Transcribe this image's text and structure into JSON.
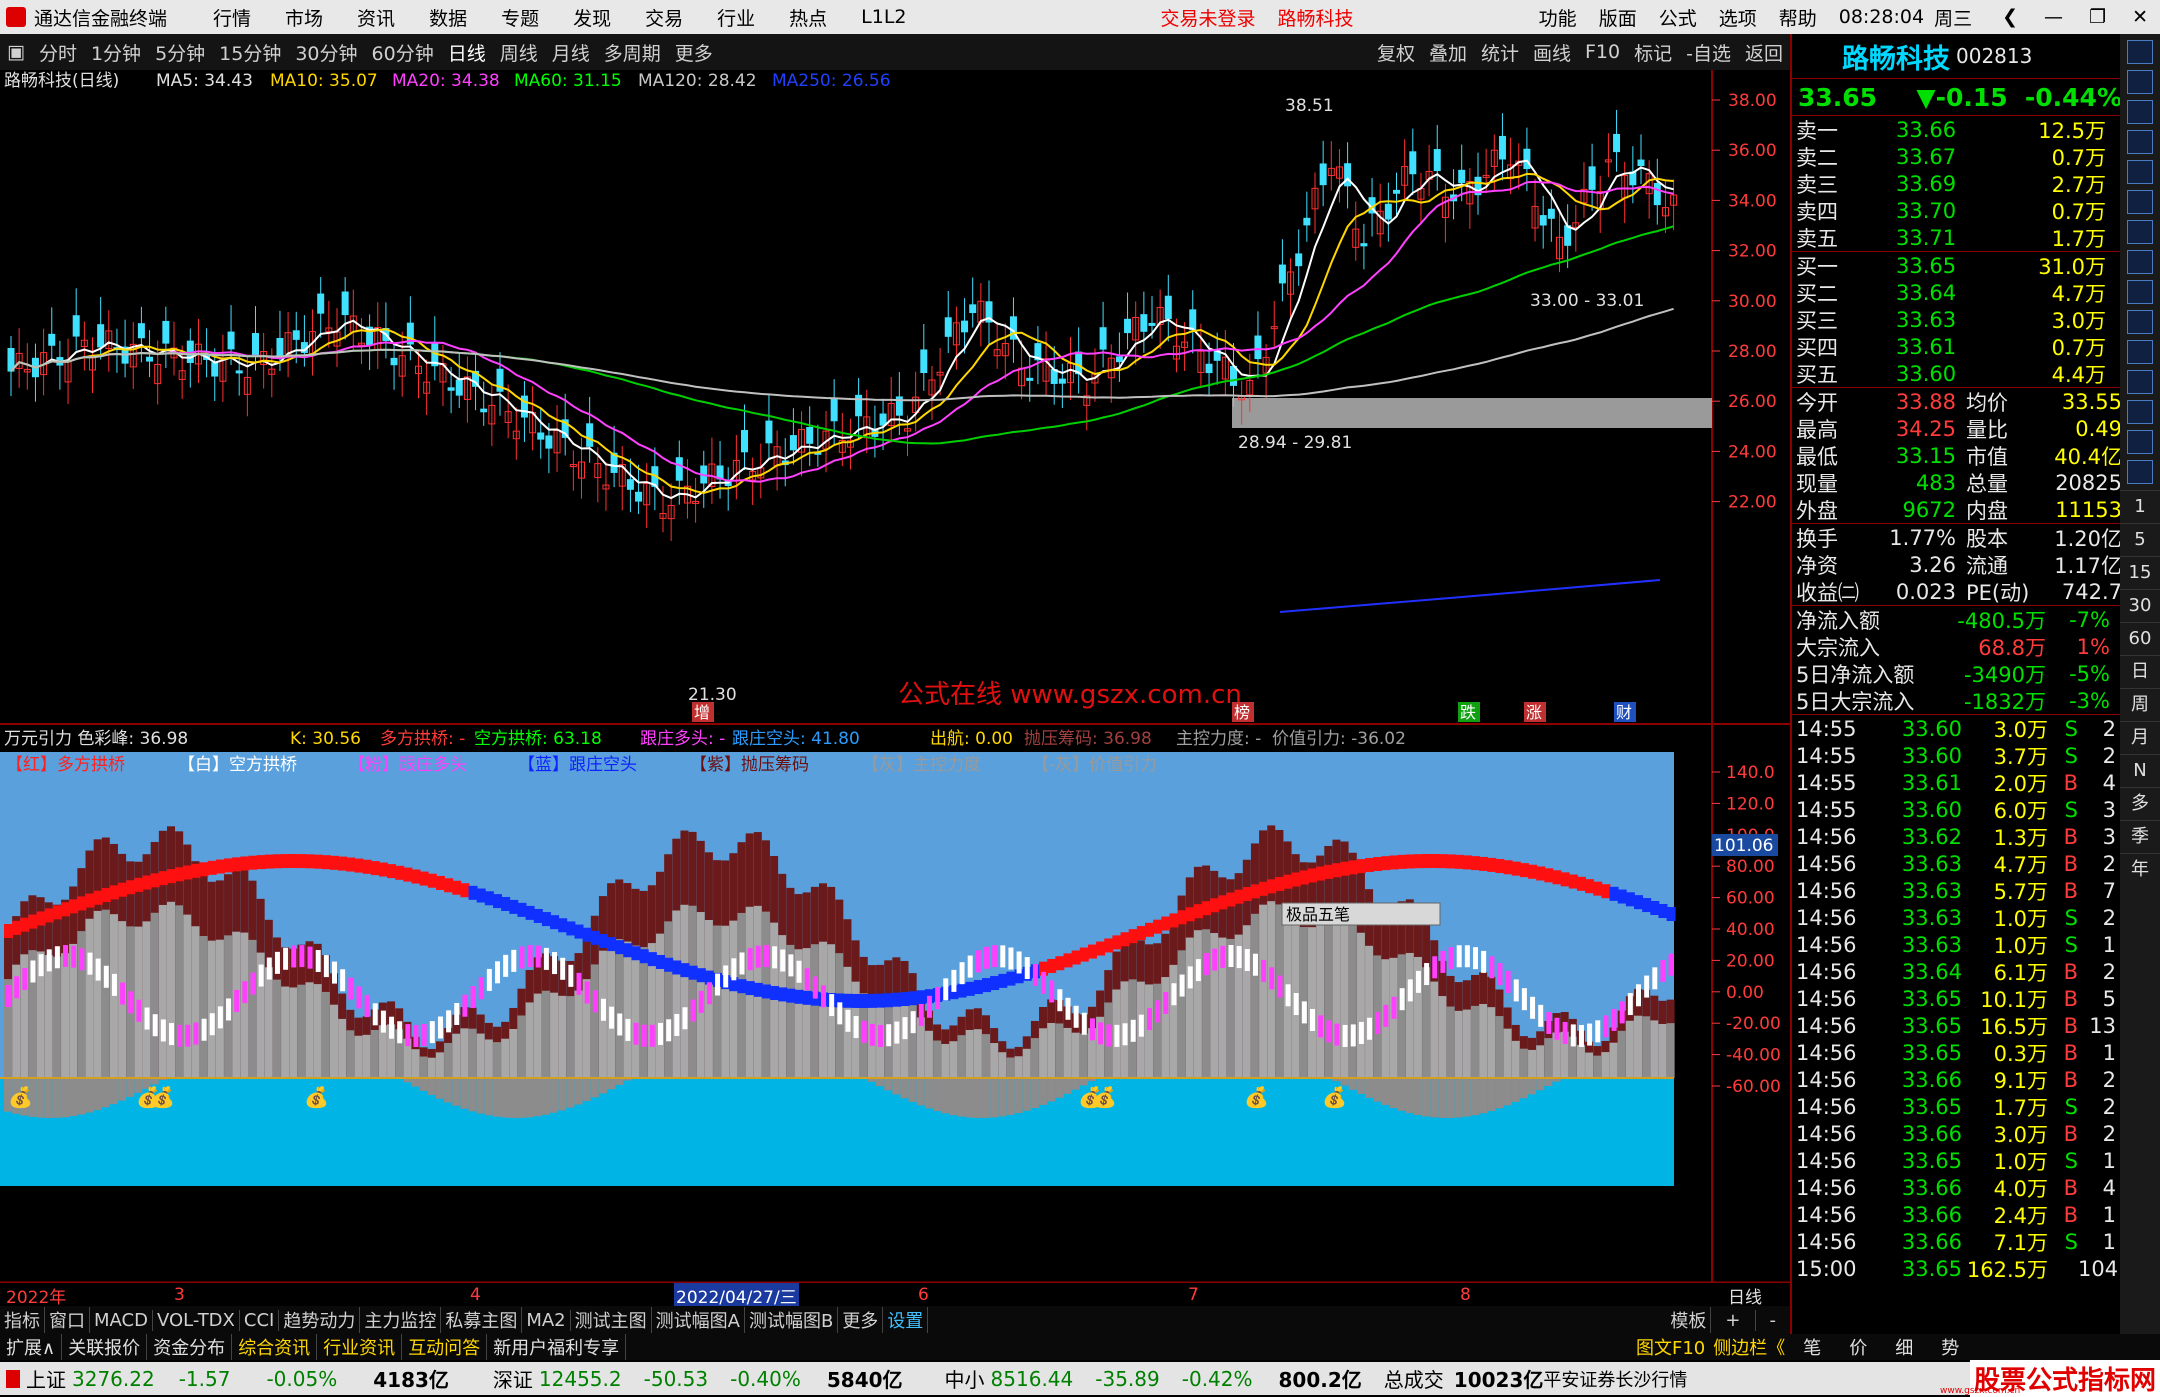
{
  "app": {
    "name": "通达信金融终端",
    "menus": [
      "行情",
      "市场",
      "资讯",
      "数据",
      "专题",
      "发现",
      "交易",
      "行业",
      "热点",
      "L1L2"
    ],
    "login": "交易未登录",
    "stock_name_title": "路畅科技",
    "right_menus": [
      "功能",
      "版面",
      "公式",
      "选项",
      "帮助"
    ],
    "time": "08:28:04",
    "weekday": "周三"
  },
  "toolbar": {
    "periods": [
      "分时",
      "1分钟",
      "5分钟",
      "15分钟",
      "30分钟",
      "60分钟",
      "日线",
      "周线",
      "月线",
      "多周期",
      "更多"
    ],
    "active": "日线",
    "right": [
      "复权",
      "叠加",
      "统计",
      "画线",
      "F10",
      "标记",
      "-自选",
      "返回"
    ]
  },
  "ma_line": {
    "stock": "路畅科技(日线)",
    "ma5": "MA5: 34.43",
    "ma10": "MA10: 35.07",
    "ma20": "MA20: 34.38",
    "ma60": "MA60: 31.15",
    "ma120": "MA120: 28.42",
    "ma250": "MA250: 26.56"
  },
  "chart_data": {
    "type": "candlestick",
    "y_ticks": [
      "38.00",
      "36.00",
      "34.00",
      "32.00",
      "30.00",
      "28.00",
      "26.00",
      "24.00",
      "22.00"
    ],
    "annotations": [
      "38.51",
      "33.00 - 33.01",
      "28.94 - 29.81",
      "21.30"
    ],
    "ind_y_ticks": [
      "140.0",
      "120.0",
      "100.0",
      "80.00",
      "60.00",
      "40.00",
      "20.00",
      "0.00",
      "-20.00",
      "-40.00",
      "-60.00"
    ],
    "ind_marker": "101.06",
    "x_labels": [
      "2022年",
      "3",
      "4",
      "2022/04/27/三",
      "6",
      "7",
      "8",
      "日线"
    ]
  },
  "indicator": {
    "title": "万元引力 色彩峰: 36.98",
    "k": "K: 30.56",
    "duo": "多方拱桥: -",
    "kong": "空方拱桥: 63.18",
    "gzdt": "跟庄多头: -",
    "gzkt": "跟庄空头: 41.80",
    "ch": "出航: 0.00",
    "pycm": "抛压筹码: 36.98",
    "zkld": "主控力度: -",
    "jzyl": "价值引力: -36.02",
    "legend": [
      "【红】多方拱桥",
      "【白】空方拱桥",
      "【粉】跟庄多头",
      "【蓝】跟庄空头",
      "【紫】抛压筹码",
      "【灰】主控力度",
      "【-灰】价值引力"
    ],
    "badge": "极品五笔"
  },
  "markers": [
    "增",
    "榜",
    "跌",
    "涨",
    "财"
  ],
  "watermark": "公式在线  www.gszx.com.cn",
  "bottom_tabs": [
    "指标",
    "窗口",
    "MACD",
    "VOL-TDX",
    "CCI",
    "趋势动力",
    "主力监控",
    "私募主图",
    "MA2",
    "测试主图",
    "测试幅图A",
    "测试幅图B",
    "更多",
    "设置"
  ],
  "bottom_right": [
    "模板",
    "+",
    "-"
  ],
  "bottom_tabs2": [
    "扩展∧",
    "关联报价",
    "资金分布",
    "综合资讯",
    "行业资讯",
    "互动问答",
    "新用户福利专享"
  ],
  "right_bottom_tabs": [
    "图文F10",
    "侧边栏《",
    "笔",
    "价",
    "细",
    "势"
  ],
  "status": {
    "sh_name": "上证",
    "sh": "3276.22",
    "sh_chg": "-1.57",
    "sh_pct": "-0.05%",
    "sh_amt": "4183亿",
    "sz_name": "深证",
    "sz": "12455.2",
    "sz_chg": "-50.53",
    "sz_pct": "-0.40%",
    "sz_amt": "5840亿",
    "zx_name": "中小",
    "zx": "8516.44",
    "zx_chg": "-35.89",
    "zx_pct": "-0.42%",
    "zx_amt": "800.2亿",
    "total_name": "总成交",
    "total": "10023亿",
    "broker": "平安证券长沙行情",
    "logo": "股票公式指标网",
    "logo_url": "www.gszx.com.cn"
  },
  "quote": {
    "name": "路畅科技",
    "code": "002813",
    "price": "33.65",
    "chg": "▼-0.15",
    "pct": "-0.44%",
    "asks": [
      {
        "label": "卖五",
        "price": "33.71",
        "vol": "1.7万"
      },
      {
        "label": "卖四",
        "price": "33.70",
        "vol": "0.7万"
      },
      {
        "label": "卖三",
        "price": "33.69",
        "vol": "2.7万"
      },
      {
        "label": "卖二",
        "price": "33.67",
        "vol": "0.7万"
      },
      {
        "label": "卖一",
        "price": "33.66",
        "vol": "12.5万"
      }
    ],
    "bids": [
      {
        "label": "买一",
        "price": "33.65",
        "vol": "31.0万"
      },
      {
        "label": "买二",
        "price": "33.64",
        "vol": "4.7万"
      },
      {
        "label": "买三",
        "price": "33.63",
        "vol": "3.0万"
      },
      {
        "label": "买四",
        "price": "33.61",
        "vol": "0.7万"
      },
      {
        "label": "买五",
        "price": "33.60",
        "vol": "4.4万"
      }
    ],
    "stats": [
      [
        "今开",
        "33.88",
        "均价",
        "33.55"
      ],
      [
        "最高",
        "34.25",
        "量比",
        "0.49"
      ],
      [
        "最低",
        "33.15",
        "市值",
        "40.4亿"
      ],
      [
        "现量",
        "483",
        "总量",
        "20825"
      ],
      [
        "外盘",
        "9672",
        "内盘",
        "11153"
      ]
    ],
    "stats2": [
      [
        "换手",
        "1.77%",
        "股本",
        "1.20亿"
      ],
      [
        "净资",
        "3.26",
        "流通",
        "1.17亿"
      ],
      [
        "收益㈡",
        "0.023",
        "PE(动)",
        "742.7"
      ]
    ],
    "flows": [
      [
        "净流入额",
        "-480.5万",
        "-7%"
      ],
      [
        "大宗流入",
        "68.8万",
        "1%"
      ],
      [
        "5日净流入额",
        "-3490万",
        "-5%"
      ],
      [
        "5日大宗流入",
        "-1832万",
        "-3%"
      ]
    ],
    "ticks": [
      [
        "14:55",
        "33.60",
        "3.0万",
        "S",
        "2"
      ],
      [
        "14:55",
        "33.60",
        "3.7万",
        "S",
        "2"
      ],
      [
        "14:55",
        "33.61",
        "2.0万",
        "B",
        "4"
      ],
      [
        "14:55",
        "33.60",
        "6.0万",
        "S",
        "3"
      ],
      [
        "14:56",
        "33.62",
        "1.3万",
        "B",
        "3"
      ],
      [
        "14:56",
        "33.63",
        "4.7万",
        "B",
        "2"
      ],
      [
        "14:56",
        "33.63",
        "5.7万",
        "B",
        "7"
      ],
      [
        "14:56",
        "33.63",
        "1.0万",
        "S",
        "2"
      ],
      [
        "14:56",
        "33.63",
        "1.0万",
        "S",
        "1"
      ],
      [
        "14:56",
        "33.64",
        "6.1万",
        "B",
        "2"
      ],
      [
        "14:56",
        "33.65",
        "10.1万",
        "B",
        "5"
      ],
      [
        "14:56",
        "33.65",
        "16.5万",
        "B",
        "13"
      ],
      [
        "14:56",
        "33.65",
        "0.3万",
        "B",
        "1"
      ],
      [
        "14:56",
        "33.66",
        "9.1万",
        "B",
        "2"
      ],
      [
        "14:56",
        "33.65",
        "1.7万",
        "S",
        "2"
      ],
      [
        "14:56",
        "33.66",
        "3.0万",
        "B",
        "2"
      ],
      [
        "14:56",
        "33.65",
        "1.0万",
        "S",
        "1"
      ],
      [
        "14:56",
        "33.66",
        "4.0万",
        "B",
        "4"
      ],
      [
        "14:56",
        "33.66",
        "2.4万",
        "B",
        "1"
      ],
      [
        "14:56",
        "33.66",
        "7.1万",
        "S",
        "1"
      ],
      [
        "15:00",
        "33.65",
        "162.5万",
        "",
        "104"
      ]
    ]
  },
  "sidebar_labels": [
    "1",
    "5",
    "15",
    "30",
    "60",
    "日",
    "周",
    "月",
    "N",
    "多",
    "季",
    "年"
  ]
}
